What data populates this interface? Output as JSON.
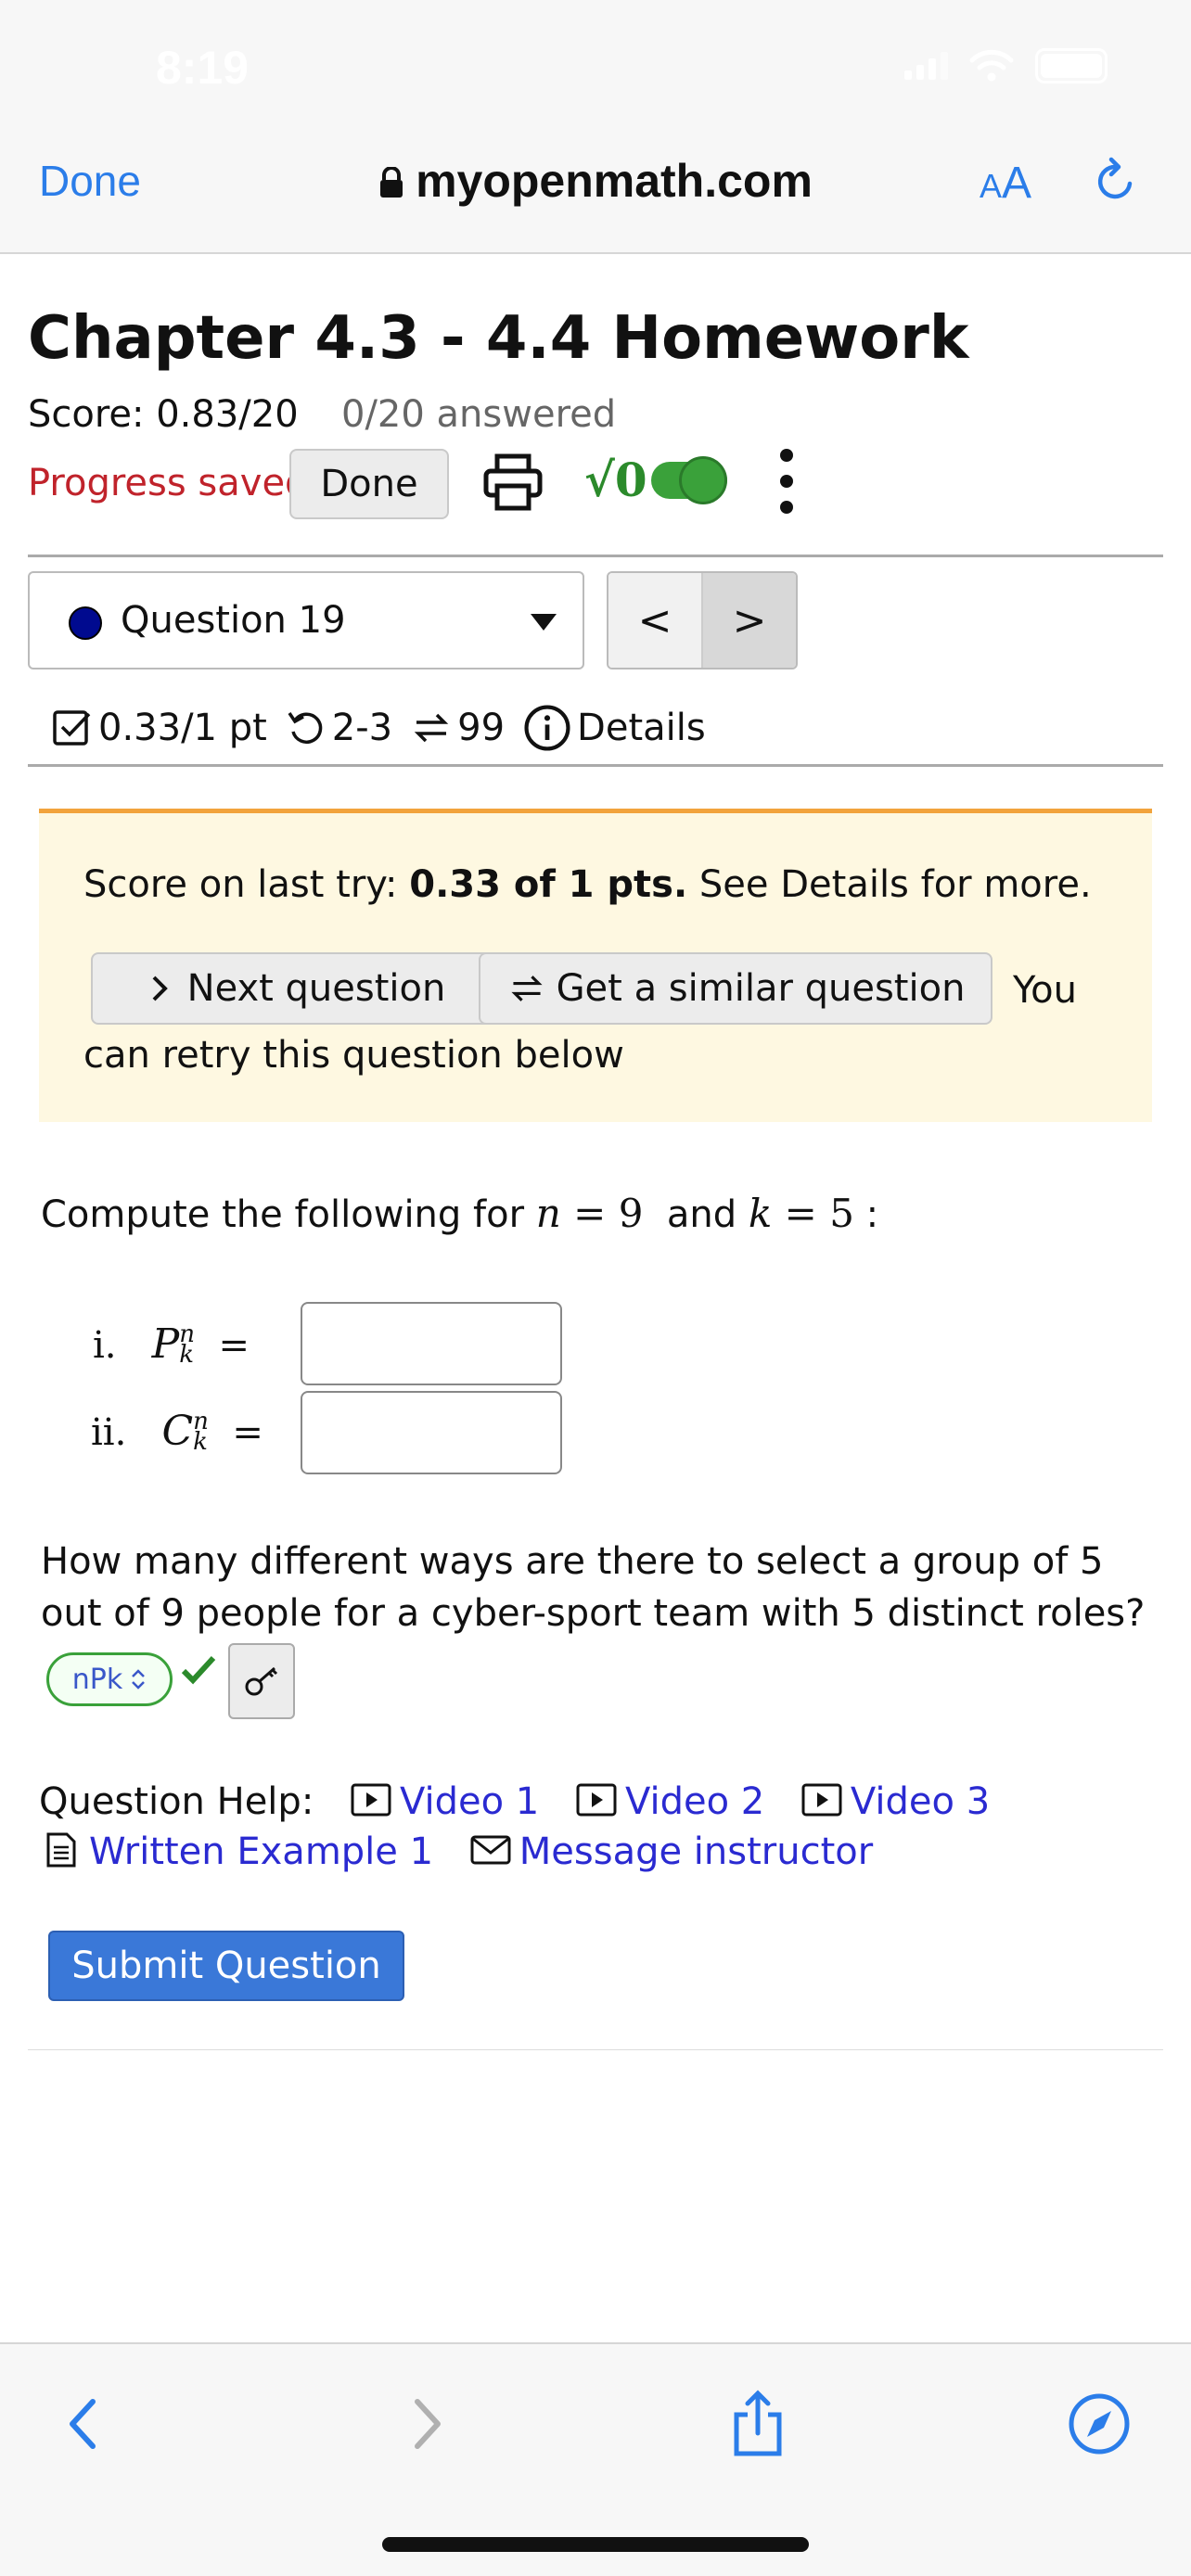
{
  "status": {
    "time": "8:19"
  },
  "browser": {
    "done": "Done",
    "url": "myopenmath.com",
    "aa_small": "A",
    "aa_large": "A"
  },
  "page": {
    "title": "Chapter 4.3 - 4.4 Homework",
    "score": "Score: 0.83/20",
    "answered": "0/20 answered",
    "progress": "Progress saved",
    "done_button": "Done",
    "sqrt_label": "√0"
  },
  "question_nav": {
    "selected": "Question 19",
    "prev": "<",
    "next": ">"
  },
  "meta": {
    "points": "0.33/1 pt",
    "attempts": "2-3",
    "versions": "99",
    "details": "Details"
  },
  "notice": {
    "prefix": "Score on last try: ",
    "score": "0.33 of 1 pts.",
    "suffix": " See Details for more.",
    "next_question": "Next question",
    "similar_question": "Get a similar question",
    "you": "You",
    "retry": "can retry this question below"
  },
  "problem": {
    "intro": "Compute the following for ",
    "n_var": "n",
    "n_val": "9",
    "and": "and",
    "k_var": "k",
    "k_val": "5",
    "colon": ":",
    "part_i_label": "i.",
    "part_i_sym": "P",
    "part_ii_label": "ii.",
    "part_ii_sym": "C",
    "sup": "n",
    "sub": "k",
    "part_i_value": "",
    "part_ii_value": "",
    "question_text": "How many different ways are there to select a group of 5 out of 9 people for a cyber-sport team with 5 distinct roles?",
    "answer_choice": "nPk"
  },
  "help": {
    "label": "Question Help:",
    "video1": "Video 1",
    "video2": "Video 2",
    "video3": "Video 3",
    "written_example": "Written Example 1",
    "message": "Message instructor"
  },
  "submit": "Submit Question",
  "colors": {
    "accent_blue": "#2b7de9",
    "progress_red": "#c0232b",
    "correct_green": "#3aa13a",
    "notice_bg": "#fef8e1",
    "notice_border": "#f2a33c",
    "link": "#2a2ad1",
    "submit_bg": "#3a78d8"
  }
}
